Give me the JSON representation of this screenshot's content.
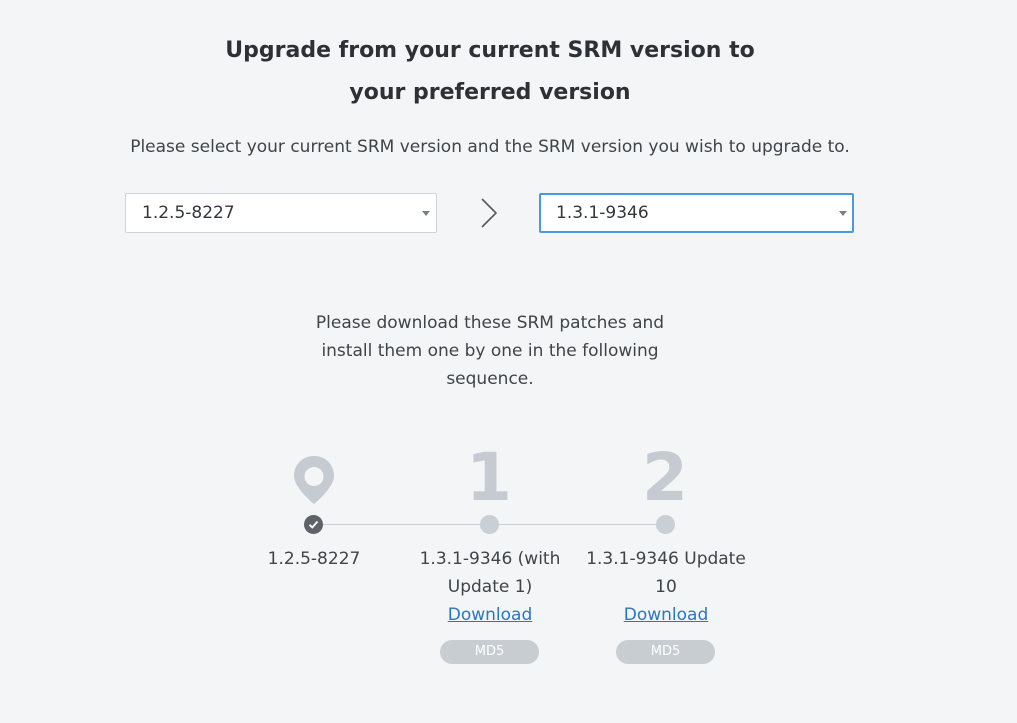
{
  "header": {
    "title_line1": "Upgrade from your current SRM version to",
    "title_line2": "your preferred version",
    "subtitle": "Please select your current SRM version and the SRM version you wish to upgrade to."
  },
  "selectors": {
    "current_version": "1.2.5-8227",
    "target_version": "1.3.1-9346"
  },
  "instructions": "Please download these SRM patches and install them one by one in the following sequence.",
  "timeline": {
    "start": {
      "label": "1.2.5-8227"
    },
    "steps": [
      {
        "number": "1",
        "label": "1.3.1-9346 (with Update 1)",
        "download_label": "Download",
        "md5_label": "MD5"
      },
      {
        "number": "2",
        "label": "1.3.1-9346 Update 10",
        "download_label": "Download",
        "md5_label": "MD5"
      }
    ]
  },
  "colors": {
    "background": "#f4f5f6",
    "link": "#2a76c6",
    "active_border": "#4a9ae2",
    "timeline_gray": "#c9cfd4",
    "current_dot": "#5f6368"
  }
}
